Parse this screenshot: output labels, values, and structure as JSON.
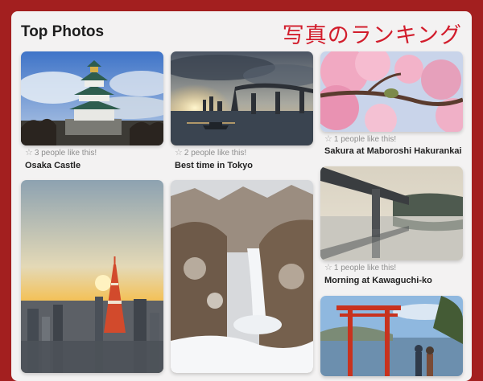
{
  "header": {
    "title": "Top Photos",
    "ranking_label": "写真のランキング"
  },
  "photos": [
    {
      "caption": "Osaka Castle",
      "likes": "3 people like this!"
    },
    {
      "caption": "Best time in Tokyo",
      "likes": "2 people like this!"
    },
    {
      "caption": "Sakura at Maboroshi Hakurankai",
      "likes": "1 people like this!"
    },
    {
      "caption": "Morning at Kawaguchi-ko",
      "likes": "1 people like this!"
    }
  ],
  "colors": {
    "frame": "#a31f1f",
    "panel": "#f3f2f2",
    "accent": "#d21d2c"
  }
}
